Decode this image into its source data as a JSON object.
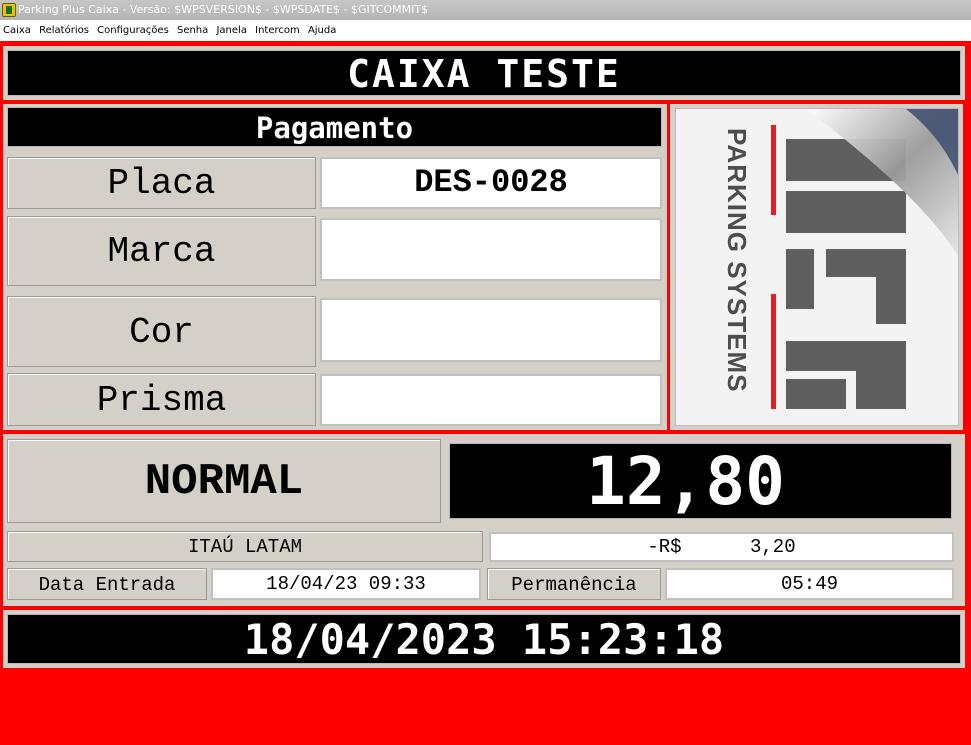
{
  "window": {
    "title": "Parking Plus Caixa - Versão: $WPSVERSION$ - $WPSDATE$ - $GITCOMMIT$"
  },
  "menu": {
    "items": [
      "Caixa",
      "Relatórios",
      "Configurações",
      "Senha",
      "Janela",
      "Intercom",
      "Ajuda"
    ]
  },
  "header": {
    "title": "CAIXA TESTE"
  },
  "section": {
    "title": "Pagamento"
  },
  "fields": {
    "placa": {
      "label": "Placa",
      "value": "DES-0028"
    },
    "marca": {
      "label": "Marca",
      "value": ""
    },
    "cor": {
      "label": "Cor",
      "value": ""
    },
    "prisma": {
      "label": "Prisma",
      "value": ""
    }
  },
  "logo": {
    "text": "PARKING SYSTEMS"
  },
  "tariff": {
    "type": "NORMAL",
    "amount": "12,80"
  },
  "discount": {
    "label": "ITAÚ LATAM",
    "value": "-R$      3,20"
  },
  "entry": {
    "label": "Data Entrada",
    "value": "18/04/23 09:33"
  },
  "stay": {
    "label": "Permanência",
    "value": "05:49"
  },
  "clock": {
    "datetime": "18/04/2023 15:23:18"
  },
  "colors": {
    "background": "#ff0000",
    "panel": "#d4d0c8",
    "display": "#000000",
    "logo_accent": "#e31e24",
    "logo_grey": "#5a5a5a"
  }
}
